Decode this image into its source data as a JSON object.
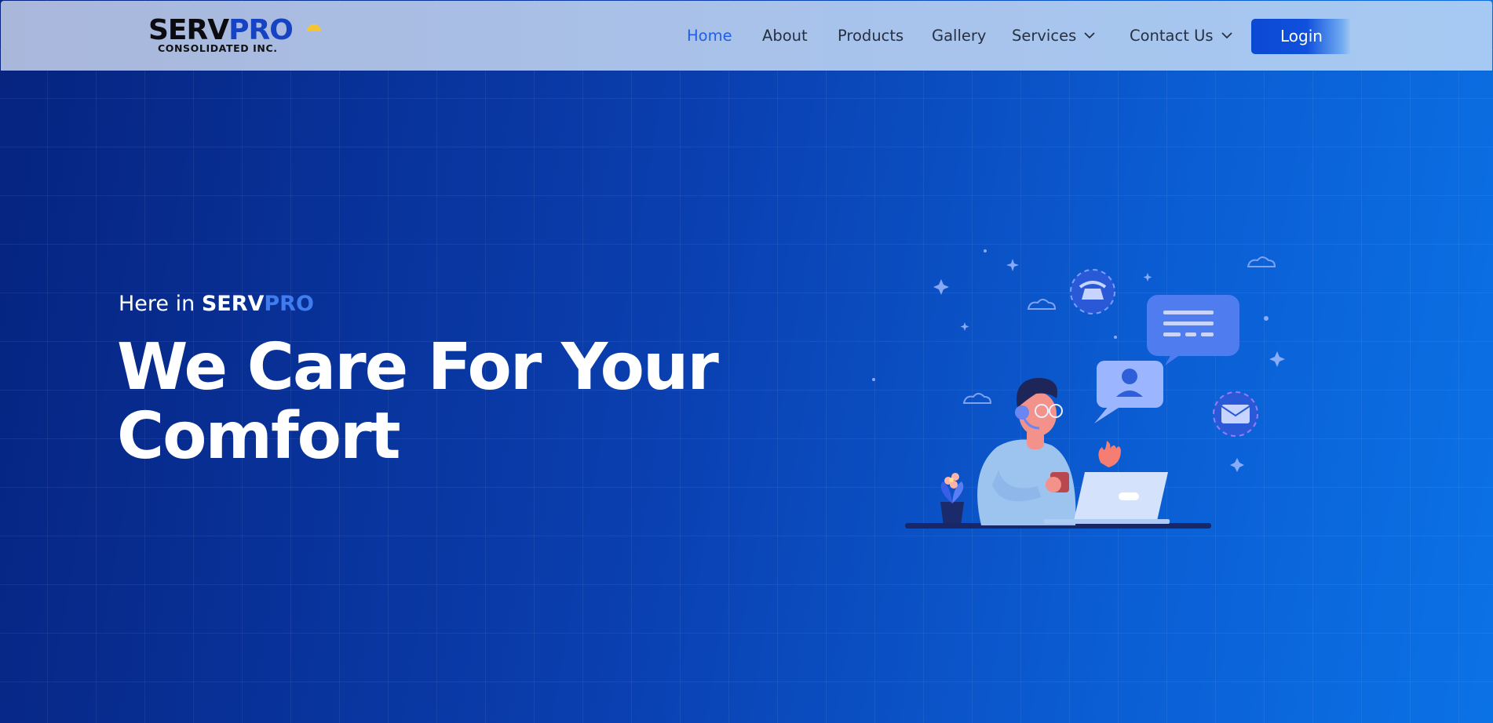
{
  "header": {
    "logo": {
      "word_black": "SERV",
      "word_blue": "PRO",
      "subtitle": "CONSOLIDATED INC."
    },
    "nav": [
      {
        "label": "Home",
        "active": true
      },
      {
        "label": "About"
      },
      {
        "label": "Products"
      },
      {
        "label": "Gallery"
      },
      {
        "label": "Services",
        "dropdown": true
      },
      {
        "label": "Contact Us",
        "dropdown": true
      }
    ],
    "login_label": "Login"
  },
  "hero": {
    "eyebrow_prefix": "Here in ",
    "eyebrow_brand_white": "SERV",
    "eyebrow_brand_blue": "PRO",
    "headline_line1": "We Care For Your",
    "headline_line2": "Comfort"
  },
  "colors": {
    "accent": "#1f5ee8",
    "login_bg": "#0c49d3",
    "hero_bg_start": "#06237f",
    "hero_bg_end": "#0b72e6"
  },
  "icons": [
    "chevron-down-icon",
    "logo-sun-icon",
    "support-agent-illustration"
  ]
}
